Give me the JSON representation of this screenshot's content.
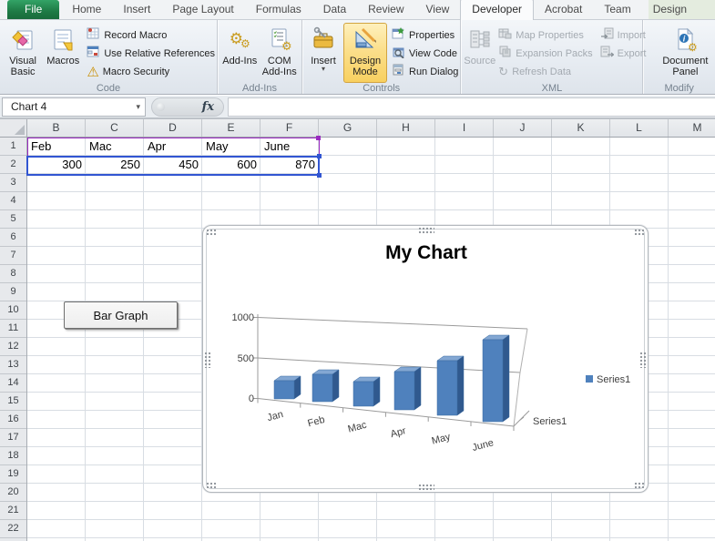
{
  "tabs": [
    {
      "label": "File"
    },
    {
      "label": "Home"
    },
    {
      "label": "Insert"
    },
    {
      "label": "Page Layout"
    },
    {
      "label": "Formulas"
    },
    {
      "label": "Data"
    },
    {
      "label": "Review"
    },
    {
      "label": "View"
    },
    {
      "label": "Developer",
      "selected": true
    },
    {
      "label": "Acrobat"
    },
    {
      "label": "Team"
    },
    {
      "label": "Design",
      "contextual": true
    }
  ],
  "ribbon": {
    "groups": [
      {
        "label": "Code",
        "buttons": [
          {
            "label": "Visual Basic"
          },
          {
            "label": "Macros"
          },
          {
            "label": "Record Macro"
          },
          {
            "label": "Use Relative References"
          },
          {
            "label": "Macro Security"
          }
        ]
      },
      {
        "label": "Add-Ins",
        "buttons": [
          {
            "label": "Add-Ins"
          },
          {
            "label": "COM Add-Ins"
          }
        ]
      },
      {
        "label": "Controls",
        "buttons": [
          {
            "label": "Insert"
          },
          {
            "label": "Design Mode",
            "active": true
          },
          {
            "label": "Properties"
          },
          {
            "label": "View Code"
          },
          {
            "label": "Run Dialog"
          }
        ]
      },
      {
        "label": "XML",
        "buttons": [
          {
            "label": "Source",
            "disabled": true
          },
          {
            "label": "Map Properties",
            "disabled": true
          },
          {
            "label": "Expansion Packs",
            "disabled": true
          },
          {
            "label": "Refresh Data",
            "disabled": true
          },
          {
            "label": "Import",
            "disabled": true
          },
          {
            "label": "Export",
            "disabled": true
          }
        ]
      },
      {
        "label": "Modify",
        "buttons": [
          {
            "label": "Document Panel"
          }
        ]
      }
    ]
  },
  "formula_bar": {
    "name_box_value": "Chart 4",
    "fx_label": "fx",
    "formula_value": ""
  },
  "sheet": {
    "columns": [
      "B",
      "C",
      "D",
      "E",
      "F",
      "G",
      "H",
      "I",
      "J",
      "K",
      "L",
      "M"
    ],
    "rows": [
      "1",
      "2",
      "3",
      "4",
      "5",
      "6",
      "7",
      "8",
      "9",
      "10",
      "11",
      "12",
      "13",
      "14",
      "15",
      "16",
      "17",
      "18",
      "19",
      "20",
      "21",
      "22"
    ],
    "row1": [
      "Feb",
      "Mac",
      "Apr",
      "May",
      "June"
    ],
    "row2": [
      "300",
      "250",
      "450",
      "600",
      "870"
    ]
  },
  "form_button": {
    "label": "Bar Graph"
  },
  "chart_data": {
    "type": "bar",
    "subtype": "3d-column",
    "title": "My Chart",
    "categories": [
      "Jan",
      "Feb",
      "Mac",
      "Apr",
      "May",
      "June"
    ],
    "series": [
      {
        "name": "Series1",
        "values": [
          200,
          300,
          250,
          450,
          600,
          870
        ]
      }
    ],
    "values_estimated": true,
    "ylim": [
      0,
      1000
    ],
    "y_ticks": [
      "1000",
      "500",
      "0"
    ],
    "series_axis_label": "Series1",
    "legend_position": "right",
    "bar_color": "#4F81BD",
    "grid": true
  },
  "colors": {
    "accent_bar": "#4F81BD",
    "range_category_border": "#9A2BC1",
    "range_data_border": "#3155D2",
    "file_tab_green": "#1E7A45",
    "design_mode_highlight": "#FBDF8C"
  }
}
